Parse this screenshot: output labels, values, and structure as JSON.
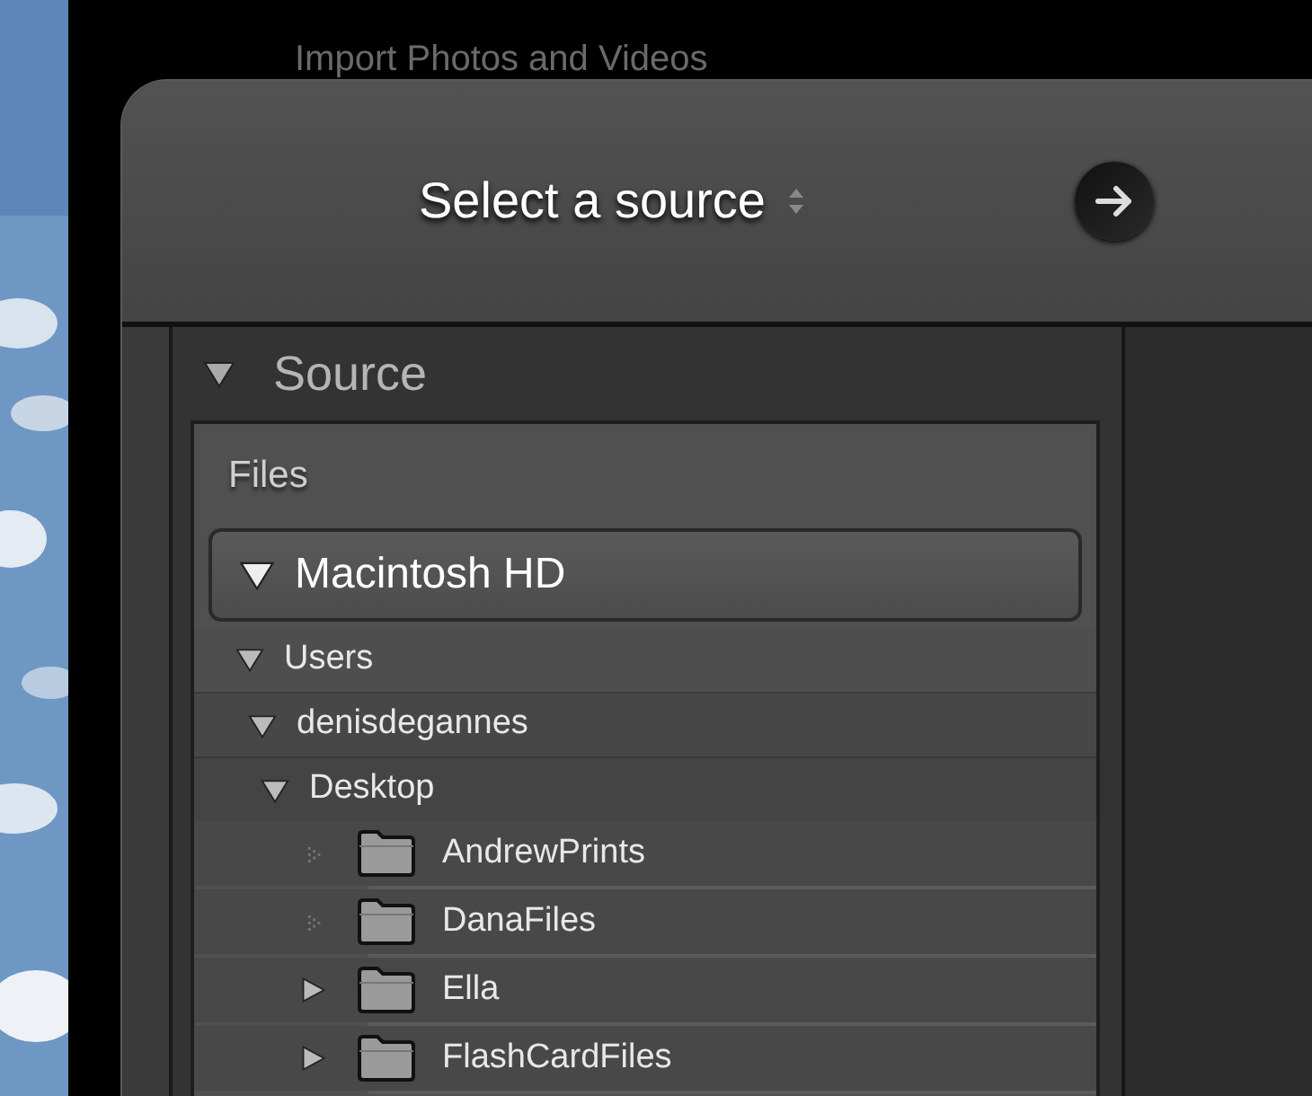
{
  "background_window": {
    "title": "Import Photos and Videos"
  },
  "dialog": {
    "title": "Select a source"
  },
  "source_panel": {
    "title": "Source",
    "expanded": true,
    "files": {
      "label": "Files",
      "volume": {
        "name": "Macintosh HD",
        "expanded": true,
        "children": [
          {
            "name": "Users",
            "kind": "path",
            "expandable": true,
            "expanded": true,
            "children": [
              {
                "name": "denisdegannes",
                "kind": "path",
                "expandable": true,
                "expanded": true,
                "children": [
                  {
                    "name": "Desktop",
                    "kind": "path",
                    "expandable": true,
                    "expanded": true,
                    "children": [
                      {
                        "name": "AndrewPrints",
                        "kind": "folder",
                        "expandable": false
                      },
                      {
                        "name": "DanaFiles",
                        "kind": "folder",
                        "expandable": false
                      },
                      {
                        "name": "Ella",
                        "kind": "folder",
                        "expandable": true,
                        "expanded": false
                      },
                      {
                        "name": "FlashCardFiles",
                        "kind": "folder",
                        "expandable": true,
                        "expanded": false
                      }
                    ]
                  }
                ]
              }
            ]
          }
        ]
      }
    }
  }
}
